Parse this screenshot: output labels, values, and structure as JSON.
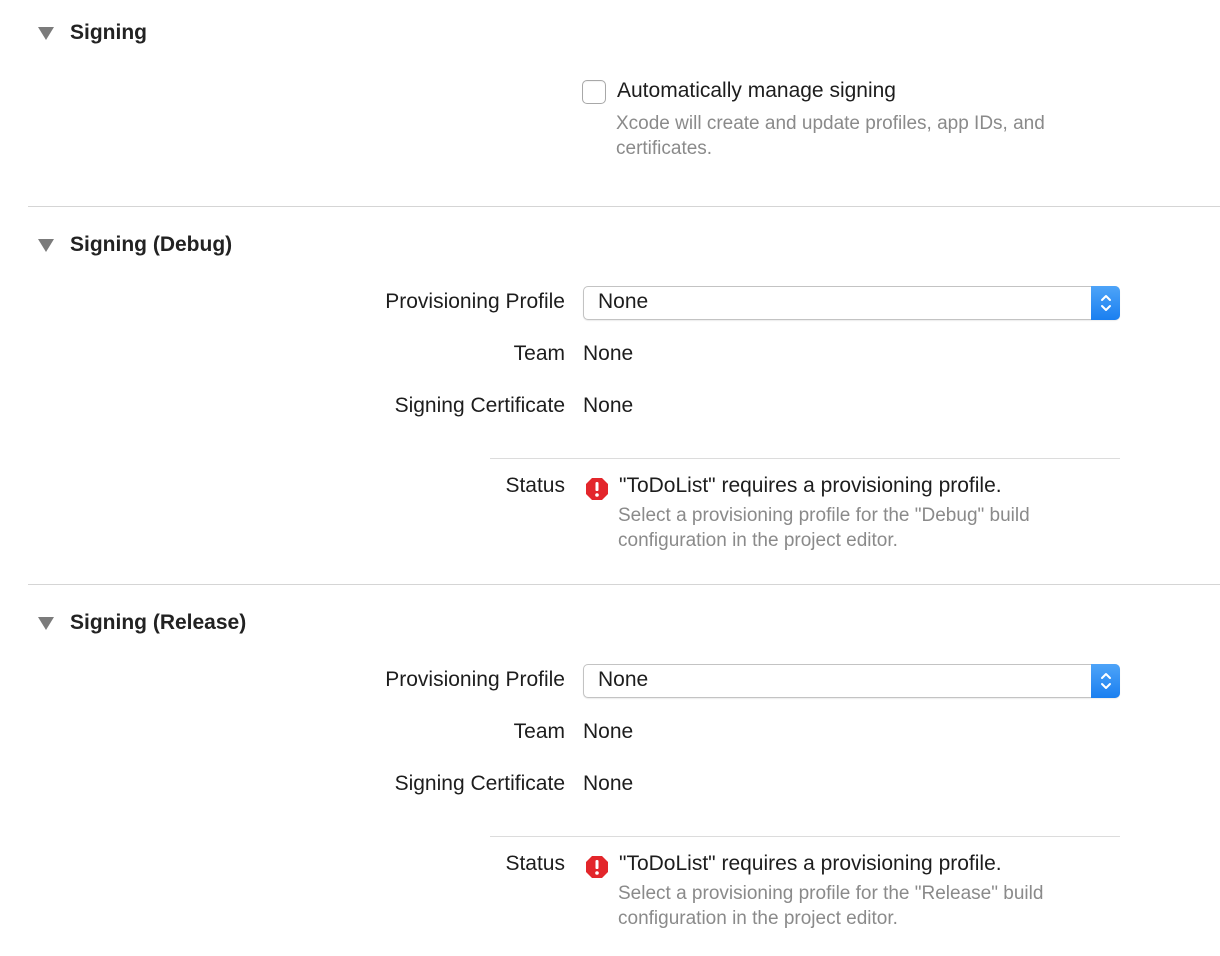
{
  "signing": {
    "title": "Signing",
    "auto_manage_label": "Automatically manage signing",
    "auto_manage_checked": false,
    "auto_manage_help_line1": "Xcode will create and update profiles, app IDs, and",
    "auto_manage_help_line2": "certificates."
  },
  "debug": {
    "title": "Signing (Debug)",
    "provisioning_label": "Provisioning Profile",
    "provisioning_value": "None",
    "team_label": "Team",
    "team_value": "None",
    "cert_label": "Signing Certificate",
    "cert_value": "None",
    "status_label": "Status",
    "status_message": "\"ToDoList\" requires a provisioning profile.",
    "status_help_line1": "Select a provisioning profile for the \"Debug\" build",
    "status_help_line2": "configuration in the project editor."
  },
  "release": {
    "title": "Signing (Release)",
    "provisioning_label": "Provisioning Profile",
    "provisioning_value": "None",
    "team_label": "Team",
    "team_value": "None",
    "cert_label": "Signing Certificate",
    "cert_value": "None",
    "status_label": "Status",
    "status_message": "\"ToDoList\" requires a provisioning profile.",
    "status_help_line1": "Select a provisioning profile for the \"Release\" build",
    "status_help_line2": "configuration in the project editor."
  },
  "colors": {
    "accent": "#1a7ff0",
    "error": "#e3262b",
    "secondary_text": "#8a8a8a"
  },
  "icons": {
    "disclosure": "disclosure-triangle-icon",
    "error": "error-octagon-icon",
    "popup": "up-down-chevron-icon"
  }
}
